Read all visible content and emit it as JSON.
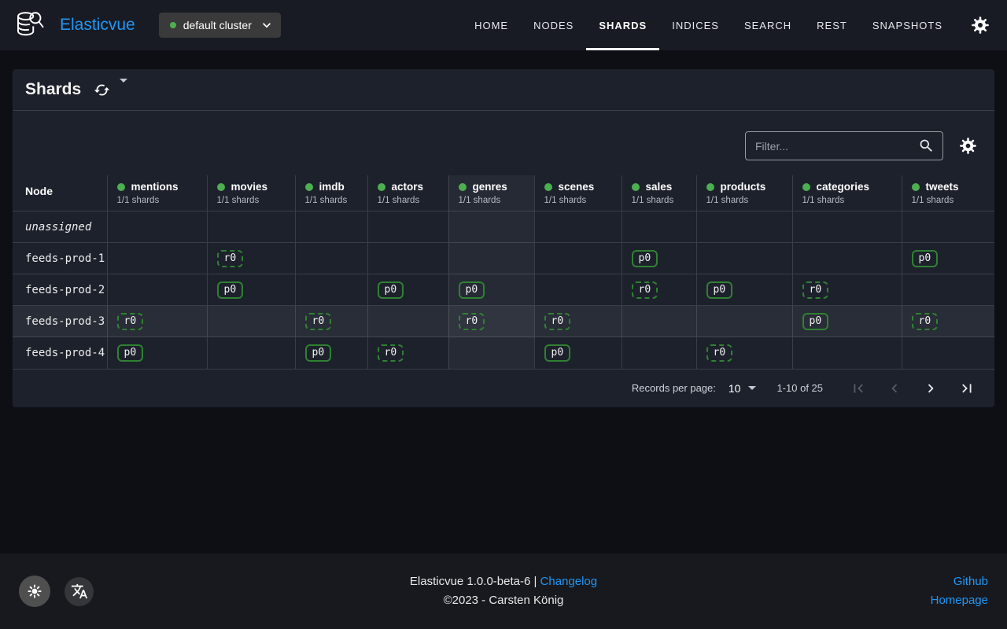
{
  "navbar": {
    "brand": "Elasticvue",
    "cluster": {
      "label": "default cluster"
    },
    "items": [
      {
        "label": "HOME",
        "active": false
      },
      {
        "label": "NODES",
        "active": false
      },
      {
        "label": "SHARDS",
        "active": true
      },
      {
        "label": "INDICES",
        "active": false
      },
      {
        "label": "SEARCH",
        "active": false
      },
      {
        "label": "REST",
        "active": false
      },
      {
        "label": "SNAPSHOTS",
        "active": false
      }
    ]
  },
  "page": {
    "title": "Shards",
    "filter_placeholder": "Filter..."
  },
  "table": {
    "node_header": "Node",
    "shard_count_label": "1/1 shards",
    "columns": [
      "mentions",
      "movies",
      "imdb",
      "actors",
      "genres",
      "scenes",
      "sales",
      "products",
      "categories",
      "tweets"
    ],
    "highlight_column": "genres",
    "highlight_row": "feeds-prod-3",
    "rows": [
      {
        "node": "unassigned",
        "unassigned": true,
        "shards": {}
      },
      {
        "node": "feeds-prod-1",
        "unassigned": false,
        "shards": {
          "movies": "r0",
          "sales": "p0",
          "tweets": "p0"
        }
      },
      {
        "node": "feeds-prod-2",
        "unassigned": false,
        "shards": {
          "movies": "p0",
          "actors": "p0",
          "genres": "p0",
          "sales": "r0",
          "products": "p0",
          "categories": "r0"
        }
      },
      {
        "node": "feeds-prod-3",
        "unassigned": false,
        "shards": {
          "mentions": "r0",
          "imdb": "r0",
          "genres": "r0",
          "scenes": "r0",
          "categories": "p0",
          "tweets": "r0"
        }
      },
      {
        "node": "feeds-prod-4",
        "unassigned": false,
        "shards": {
          "mentions": "p0",
          "imdb": "p0",
          "actors": "r0",
          "scenes": "p0",
          "products": "r0"
        }
      }
    ]
  },
  "pagination": {
    "records_per_page_label": "Records per page:",
    "records_per_page": "10",
    "range_label": "1-10 of 25"
  },
  "footer": {
    "version_line": "Elasticvue 1.0.0-beta-6 |",
    "changelog_label": "Changelog",
    "copyright": "©2023 - Carsten König",
    "links": [
      {
        "label": "Github"
      },
      {
        "label": "Homepage"
      }
    ]
  },
  "colors": {
    "accent_blue": "#2196f3",
    "status_green": "#4caf50",
    "shard_border_green": "#2f8132",
    "card_bg": "#1d212c",
    "navbar_bg": "#181b23",
    "page_bg": "#0e0f14",
    "footer_bg": "#17191f"
  }
}
